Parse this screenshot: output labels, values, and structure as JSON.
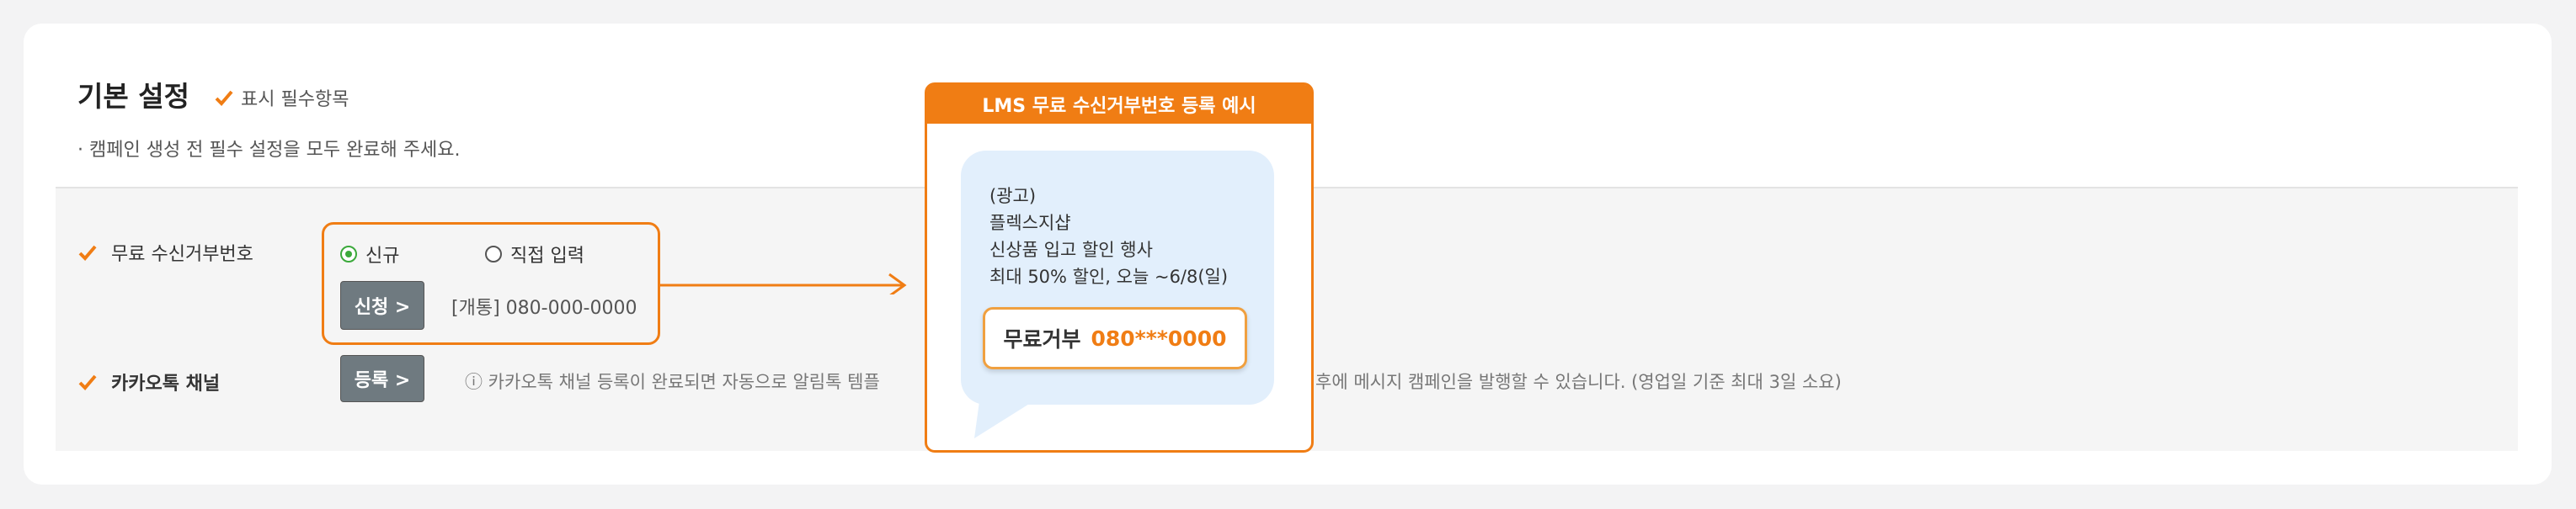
{
  "section": {
    "title": "기본 설정",
    "required_marker": "표시 필수항목",
    "note": "· 캠페인 생성 전 필수 설정을 모두 완료해 주세요."
  },
  "colors": {
    "accent": "#f07d14",
    "check": "#f07d14",
    "radio_on": "#3ba93b",
    "button": "#6f7a80"
  },
  "rows": {
    "unsubscribe": {
      "label": "무료 수신거부번호",
      "options": [
        "신규",
        "직접 입력"
      ],
      "selected": "신규",
      "button": "신청 >",
      "number": "[개통] 080-000-0000"
    },
    "kakao": {
      "label": "카카오톡 채널",
      "button": "등록 >",
      "note_start": "ⓘ 카카오톡 채널 등록이 완료되면 자동으로 알림톡 템플",
      "note_end": "후에 메시지 캠페인을 발행할 수 있습니다. (영업일 기준 최대 3일 소요)"
    }
  },
  "example": {
    "header": "LMS 무료 수신거부번호 등록 예시",
    "lines": [
      "(광고)",
      "플렉스지샵",
      "신상품 입고 할인 행사",
      "최대 50% 할인, 오늘 ~6/8(일)"
    ],
    "reject_label": "무료거부",
    "reject_number": "080***0000"
  }
}
